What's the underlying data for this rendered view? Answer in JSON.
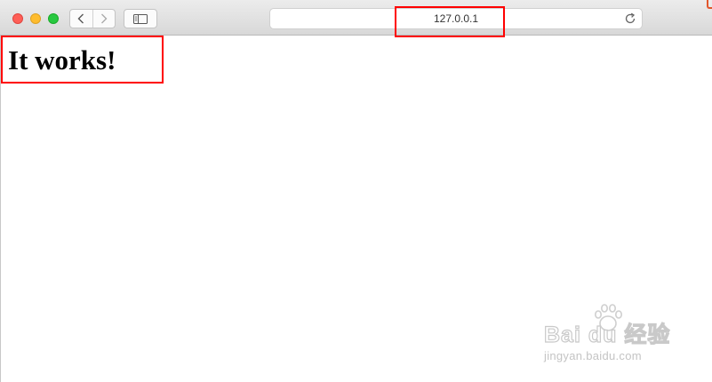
{
  "browser": {
    "address": "127.0.0.1"
  },
  "page": {
    "heading": "It works!"
  },
  "watermark": {
    "brand": "Bai du 经验",
    "site": "jingyan.baidu.com"
  },
  "colors": {
    "highlight": "#ff0000",
    "traffic_close": "#fe5f57",
    "traffic_minimize": "#febc2e",
    "traffic_maximize": "#28c840"
  },
  "icons": [
    "back-arrow-icon",
    "forward-arrow-icon",
    "sidebar-icon",
    "reload-icon",
    "paw-icon"
  ]
}
